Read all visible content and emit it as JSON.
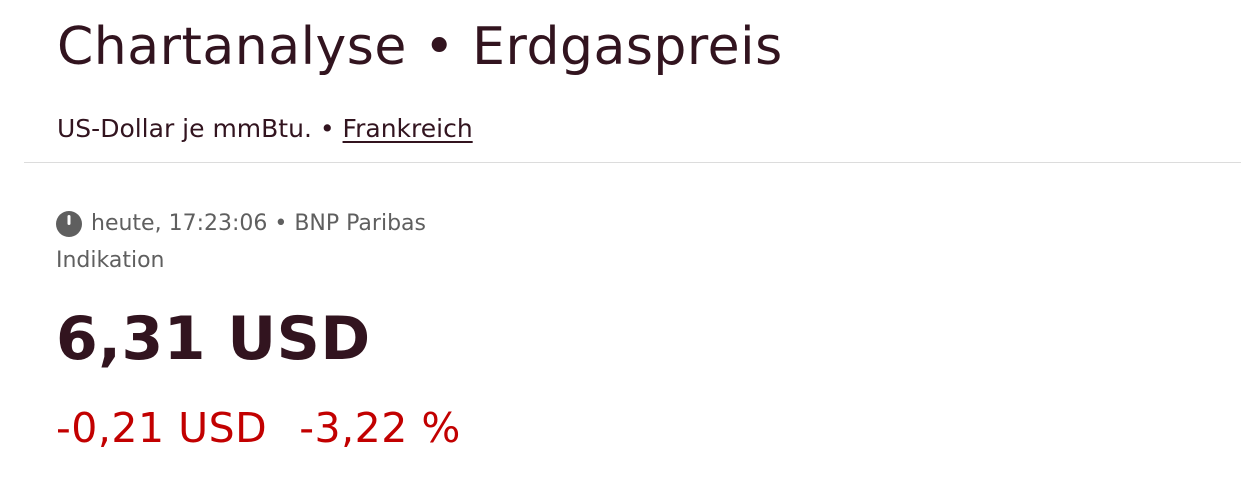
{
  "header": {
    "title": "Chartanalyse • Erdgaspreis",
    "unit_text": "US-Dollar je mmBtu.",
    "separator": " • ",
    "country_link": "Frankreich"
  },
  "quote": {
    "time_text": "heute, 17:23:06 • BNP Paribas",
    "status_text": "Indikation",
    "price": "6,31 USD",
    "change_abs": "-0,21 USD",
    "change_pct": "-3,22 %"
  },
  "icons": {
    "time": "clock-icon"
  },
  "colors": {
    "text": "#32141f",
    "muted": "#5f5f5f",
    "negative": "#c20000"
  }
}
